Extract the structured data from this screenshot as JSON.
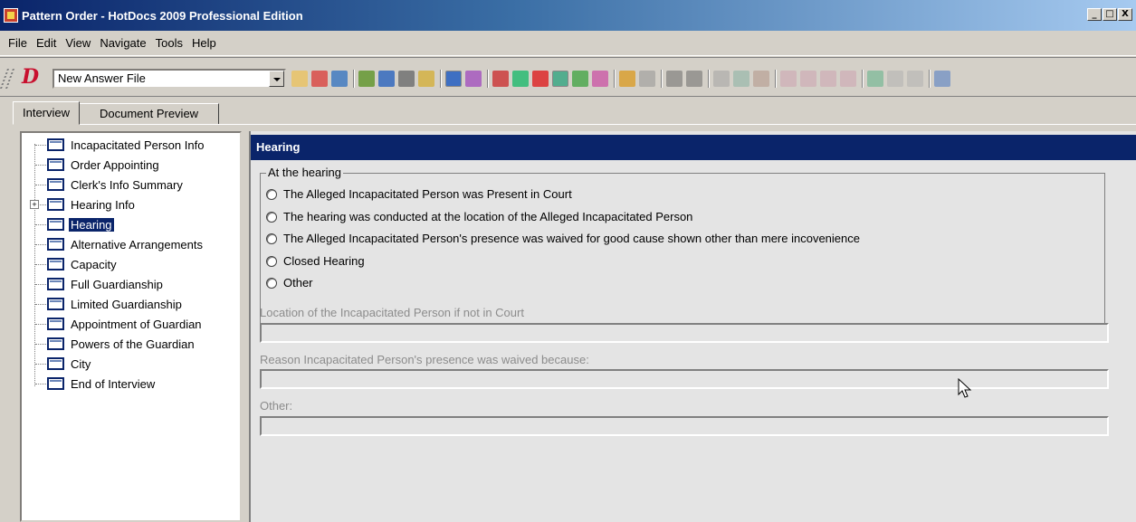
{
  "window": {
    "title": "Pattern Order - HotDocs 2009 Professional Edition",
    "controls": [
      "_",
      "□",
      "X"
    ]
  },
  "menu": [
    "File",
    "Edit",
    "View",
    "Navigate",
    "Tools",
    "Help"
  ],
  "toolbar": {
    "logo": "D",
    "answer_file": "New Answer File",
    "icons": [
      "new-answer-icon",
      "open-answer-icon",
      "save-answer-icon",
      "assemble-icon",
      "print-icon",
      "save-icon",
      "print-preview-icon",
      "interview-icon",
      "help-icon",
      "spell-check-icon",
      "link-icon",
      "answer-summary-icon",
      "data-source-icon",
      "checklist-icon",
      "whats-this-icon",
      "edit-icon",
      "eraser-icon",
      "undo-icon",
      "redo-icon",
      "cut-icon",
      "copy-icon",
      "paste-icon",
      "indent-icon",
      "outdent-icon",
      "insert-row-icon",
      "append-row-icon",
      "sort-icon",
      "clear-icon",
      "delete-icon",
      "exit-icon"
    ]
  },
  "tabs": {
    "interview": "Interview",
    "document_preview": "Document Preview"
  },
  "outline": [
    {
      "label": "Incapacitated Person Info"
    },
    {
      "label": "Order Appointing"
    },
    {
      "label": "Clerk's Info Summary"
    },
    {
      "label": "Hearing Info",
      "expandable": true
    },
    {
      "label": "Hearing",
      "selected": true
    },
    {
      "label": "Alternative Arrangements"
    },
    {
      "label": "Capacity"
    },
    {
      "label": "Full Guardianship"
    },
    {
      "label": "Limited Guardianship"
    },
    {
      "label": "Appointment of Guardian"
    },
    {
      "label": "Powers of the Guardian"
    },
    {
      "label": "City"
    },
    {
      "label": "End of Interview"
    }
  ],
  "dialog": {
    "title": "Hearing",
    "group_label": "At the hearing",
    "options": [
      "The Alleged Incapacitated Person was Present in Court",
      "The hearing was conducted at the location of the Alleged Incapacitated Person",
      "The Alleged Incapacitated Person's presence was waived for good cause shown other than mere incovenience",
      "Closed Hearing",
      "Other"
    ],
    "fields": [
      {
        "label": "Location of the Incapacitated Person if not in Court",
        "value": ""
      },
      {
        "label": "Reason Incapacitated Person's presence was waived because:",
        "value": ""
      },
      {
        "label": "Other:",
        "value": ""
      }
    ]
  }
}
